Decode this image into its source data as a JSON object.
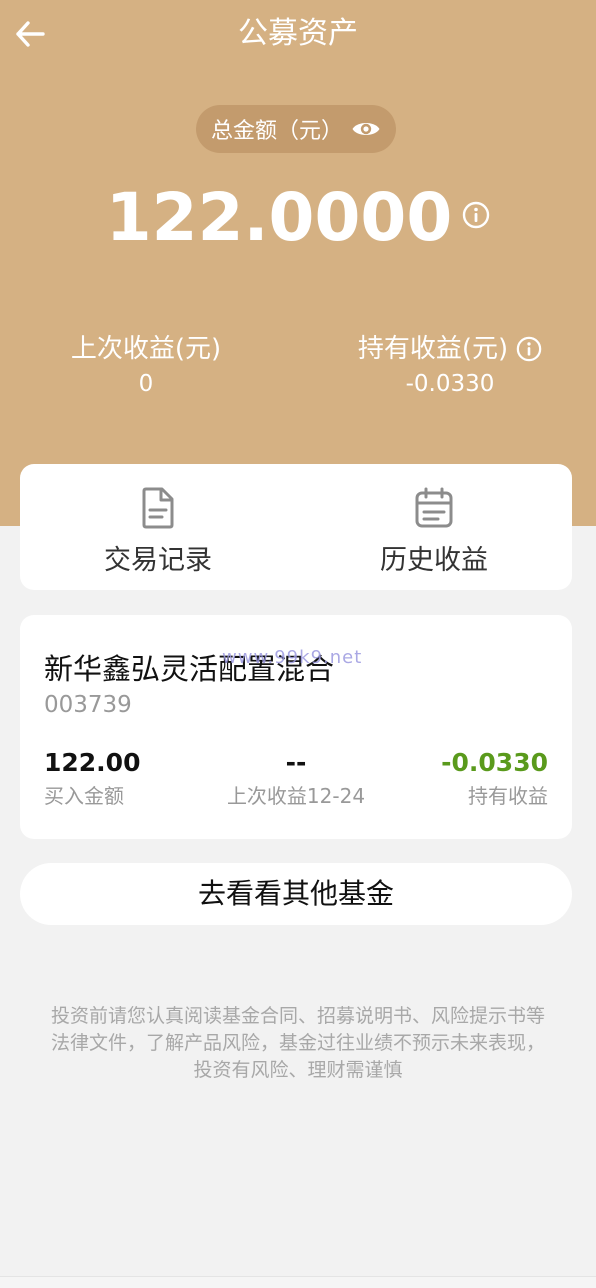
{
  "colors": {
    "header_bg": "#d5b183",
    "pill_bg": "#c39b6d",
    "page_bg": "#f2f2f2",
    "negative": "#5a9a1c"
  },
  "nav": {
    "title": "公募资产",
    "back_icon": "arrow-left-icon"
  },
  "summary": {
    "total_label": "总金额（元）",
    "total_amount": "122.0000",
    "eye_icon": "eye-icon",
    "info_icon": "info-icon",
    "last_income_label": "上次收益(元)",
    "last_income_value": "0",
    "holding_income_label": "持有收益(元)",
    "holding_income_value": "-0.0330"
  },
  "quick_actions": [
    {
      "label": "交易记录",
      "icon": "document-icon"
    },
    {
      "label": "历史收益",
      "icon": "calendar-icon"
    }
  ],
  "fund": {
    "name": "新华鑫弘灵活配置混合",
    "code": "003739",
    "watermark": "www.99k9.net",
    "buy_amount_value": "122.00",
    "buy_amount_label": "买入金额",
    "last_income_value": "--",
    "last_income_label": "上次收益12-24",
    "holding_income_value": "-0.0330",
    "holding_income_label": "持有收益"
  },
  "other_funds_button": "去看看其他基金",
  "disclaimer": {
    "line1": "投资前请您认真阅读基金合同、招募说明书、风险提示书等",
    "line2": "法律文件，了解产品风险，基金过往业绩不预示未来表现，",
    "line3": "投资有风险、理财需谨慎"
  }
}
